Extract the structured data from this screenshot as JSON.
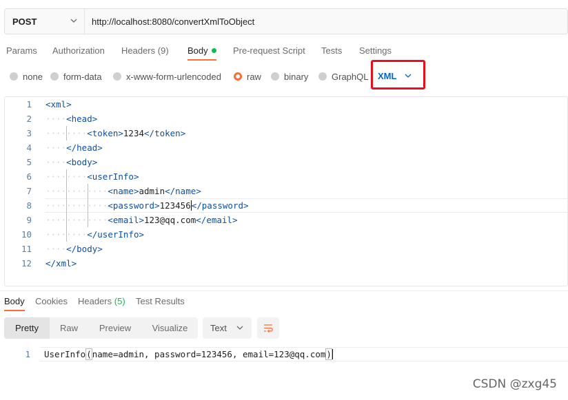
{
  "request": {
    "method": "POST",
    "url": "http://localhost:8080/convertXmlToObject"
  },
  "request_tabs": [
    {
      "label": "Params"
    },
    {
      "label": "Authorization"
    },
    {
      "label": "Headers",
      "count": "(9)"
    },
    {
      "label": "Body",
      "active": true,
      "indicator": "green-dot"
    },
    {
      "label": "Pre-request Script"
    },
    {
      "label": "Tests"
    },
    {
      "label": "Settings"
    }
  ],
  "body_types": [
    {
      "label": "none"
    },
    {
      "label": "form-data"
    },
    {
      "label": "x-www-form-urlencoded"
    },
    {
      "label": "raw",
      "checked": true
    },
    {
      "label": "binary"
    },
    {
      "label": "GraphQL"
    }
  ],
  "raw_format": "XML",
  "editor": {
    "lines": [
      {
        "n": "1",
        "indent": 0,
        "open": "<xml>",
        "text": "",
        "close": ""
      },
      {
        "n": "2",
        "indent": 1,
        "open": "<head>",
        "text": "",
        "close": ""
      },
      {
        "n": "3",
        "indent": 2,
        "open": "<token>",
        "text": "1234",
        "close": "</token>"
      },
      {
        "n": "4",
        "indent": 1,
        "open": "</head>",
        "text": "",
        "close": ""
      },
      {
        "n": "5",
        "indent": 1,
        "open": "<body>",
        "text": "",
        "close": ""
      },
      {
        "n": "6",
        "indent": 2,
        "open": "<userInfo>",
        "text": "",
        "close": ""
      },
      {
        "n": "7",
        "indent": 3,
        "open": "<name>",
        "text": "admin",
        "close": "</name>"
      },
      {
        "n": "8",
        "indent": 3,
        "open": "<password>",
        "text": "123456",
        "close": "</password>"
      },
      {
        "n": "9",
        "indent": 3,
        "open": "<email>",
        "text": "123@qq.com",
        "close": "</email>"
      },
      {
        "n": "10",
        "indent": 2,
        "open": "</userInfo>",
        "text": "",
        "close": ""
      },
      {
        "n": "11",
        "indent": 1,
        "open": "</body>",
        "text": "",
        "close": ""
      },
      {
        "n": "12",
        "indent": 0,
        "open": "</xml>",
        "text": "",
        "close": ""
      }
    ],
    "highlighted_line": "8"
  },
  "response_tabs": [
    {
      "label": "Body",
      "active": true
    },
    {
      "label": "Cookies"
    },
    {
      "label": "Headers",
      "count": "(5)"
    },
    {
      "label": "Test Results"
    }
  ],
  "view_modes": [
    {
      "label": "Pretty",
      "active": true
    },
    {
      "label": "Raw"
    },
    {
      "label": "Preview"
    },
    {
      "label": "Visualize"
    }
  ],
  "format_select": "Text",
  "response": {
    "line_number": "1",
    "prefix": "UserInfo",
    "open_paren": "(",
    "middle": "name=admin, password=123456, email=123@qq.com",
    "close_paren": ")"
  },
  "watermark": "CSDN @zxg45",
  "colors": {
    "accent": "#ff6c37",
    "link": "#0265d2",
    "highlight_box": "#e5101b",
    "status_green": "#0cbb52"
  }
}
